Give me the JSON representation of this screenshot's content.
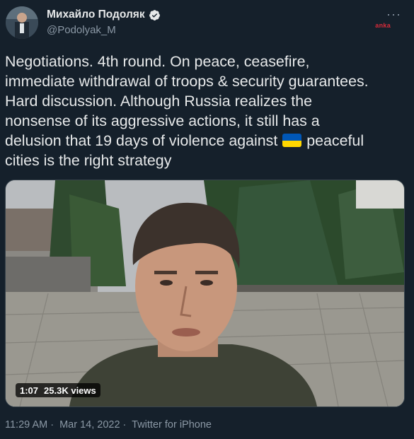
{
  "author": {
    "name": "Михайло Подоляк",
    "handle": "@Podolyak_M",
    "verified": true
  },
  "watermark": "anka",
  "tweet": {
    "text_before_flag": "Negotiations. 4th round. On peace, ceasefire,\nimmediate withdrawal of troops & security guarantees.\nHard discussion. Although Russia realizes the\nnonsense of its aggressive actions, it still has a\ndelusion that 19 days of violence against ",
    "flag_icon": "ukraine-flag",
    "text_after_flag": " peaceful\ncities is the right strategy"
  },
  "video": {
    "duration": "1:07",
    "views": "25.3K views"
  },
  "meta": {
    "time": "11:29 AM",
    "separator": "·",
    "date": "Mar 14, 2022",
    "source": "Twitter for iPhone"
  },
  "colors": {
    "background": "#15202b",
    "text": "#e7e9ea",
    "secondary": "#8b98a5",
    "verified": "#e7e9ea",
    "flag_blue": "#0057b7",
    "flag_yellow": "#ffd700"
  },
  "icons": [
    "verified-badge-icon",
    "more-options-icon",
    "ukraine-flag"
  ]
}
